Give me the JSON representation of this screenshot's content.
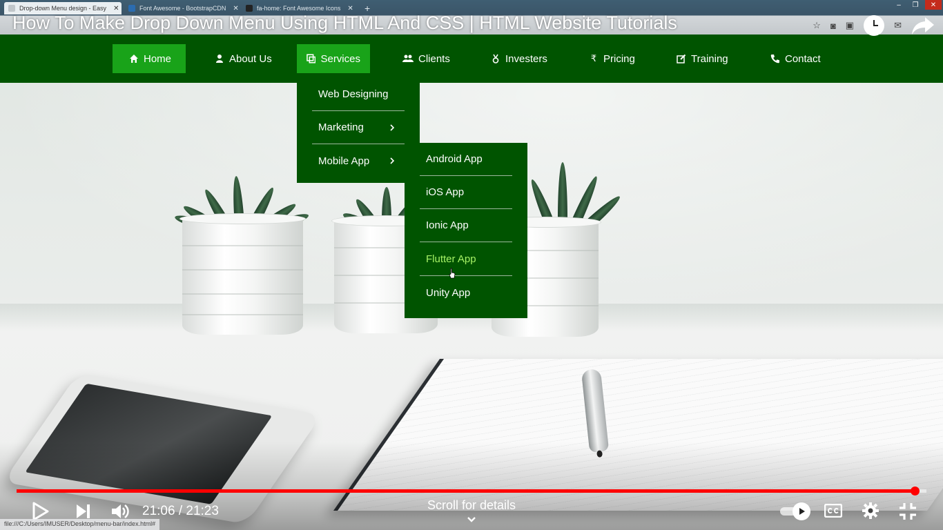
{
  "browser": {
    "tabs": [
      {
        "title": "Drop-down Menu design - Easy",
        "favicon_color": "#c0c6ca"
      },
      {
        "title": "Font Awesome - BootstrapCDN",
        "favicon_color": "#2b6cb0"
      },
      {
        "title": "fa-home: Font Awesome Icons",
        "favicon_color": "#222222"
      }
    ],
    "new_tab_label": "+",
    "window_controls": [
      "–",
      "❐",
      "✕"
    ],
    "status_url": "file:///C:/Users/IMUSER/Desktop/menu-bar/index.html#"
  },
  "video": {
    "title": "How To Make Drop Down Menu Using HTML And CSS | HTML Website Tutorials",
    "current_time": "21:06",
    "duration": "21:23",
    "time_display": "21:06 / 21:23",
    "progress_fraction": 0.987,
    "scroll_hint": "Scroll for details",
    "accent_color": "#ff0000"
  },
  "nav": {
    "background_color": "#005400",
    "active_color": "#19a319",
    "items": [
      {
        "label": "Home",
        "icon": "home-icon",
        "active": true
      },
      {
        "label": "About Us",
        "icon": "user-icon",
        "active": false
      },
      {
        "label": "Services",
        "icon": "clone-icon",
        "active": true
      },
      {
        "label": "Clients",
        "icon": "users-icon",
        "active": false
      },
      {
        "label": "Investers",
        "icon": "medal-icon",
        "active": false
      },
      {
        "label": "Pricing",
        "icon": "rupee-icon",
        "active": false
      },
      {
        "label": "Training",
        "icon": "edit-icon",
        "active": false
      },
      {
        "label": "Contact",
        "icon": "phone-icon",
        "active": false
      }
    ]
  },
  "services_menu": {
    "items": [
      {
        "label": "Web Designing",
        "has_submenu": false
      },
      {
        "label": "Marketing",
        "has_submenu": true
      },
      {
        "label": "Mobile App",
        "has_submenu": true
      }
    ]
  },
  "mobile_app_submenu": {
    "hover_color": "#a6f266",
    "items": [
      {
        "label": "Android App",
        "hovered": false
      },
      {
        "label": "iOS App",
        "hovered": false
      },
      {
        "label": "Ionic App",
        "hovered": false
      },
      {
        "label": "Flutter App",
        "hovered": true
      },
      {
        "label": "Unity App",
        "hovered": false
      }
    ]
  }
}
